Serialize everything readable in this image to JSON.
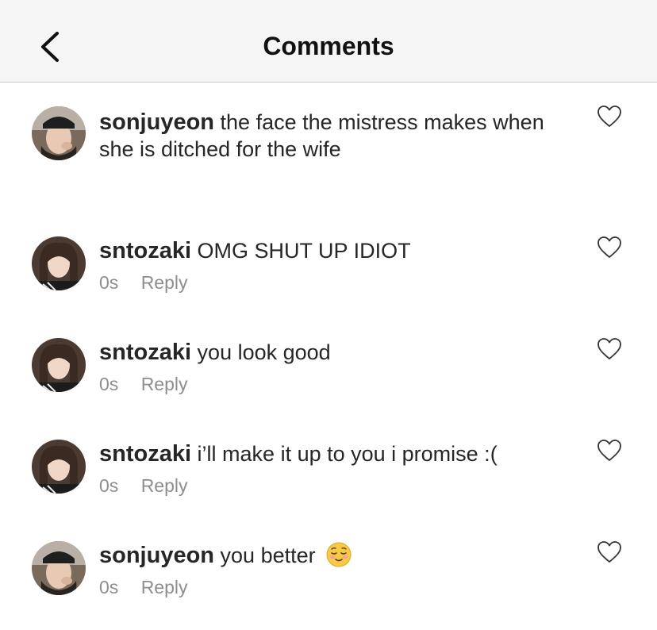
{
  "header": {
    "title": "Comments",
    "back_icon": "chevron-left-icon"
  },
  "comments": [
    {
      "username": "sonjuyeon",
      "text": "the face the mistress makes when she is ditched for the wife",
      "time": "",
      "reply": ""
    },
    {
      "username": "sntozaki",
      "text": "OMG SHUT UP IDIOT",
      "time": "0s",
      "reply": "Reply"
    },
    {
      "username": "sntozaki",
      "text": "you look good",
      "time": "0s",
      "reply": "Reply"
    },
    {
      "username": "sntozaki",
      "text": "i’ll make it up to you i promise :(",
      "time": "0s",
      "reply": "Reply"
    },
    {
      "username": "sonjuyeon",
      "text": "you better",
      "time": "0s",
      "reply": "Reply",
      "emoji": "relieved-face-emoji"
    }
  ],
  "colors": {
    "header_bg": "#f5f5f5",
    "text": "#262626",
    "meta": "#8e8e8e"
  }
}
